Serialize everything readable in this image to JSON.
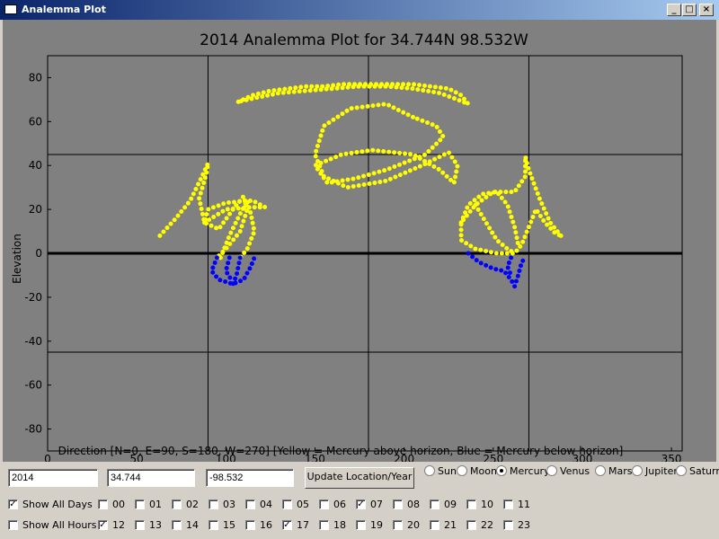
{
  "window": {
    "title": "Analemma Plot",
    "minimize": "_",
    "maximize": "□",
    "close": "×"
  },
  "plot": {
    "title": "2014 Analemma Plot for  34.744N  98.532W",
    "xlabel": "Direction [N=0, E=90, S=180, W=270] [Yellow = Mercury above horizon, Blue = Mercury below horizon]",
    "ylabel": "Elevation",
    "xticks": [
      "0",
      "50",
      "100",
      "150",
      "200",
      "250",
      "300",
      "350"
    ],
    "yticks": [
      "80",
      "60",
      "40",
      "20",
      "0",
      "-20",
      "-40",
      "-60",
      "-80"
    ],
    "colors": {
      "above": "#ffff00",
      "below": "#0000ff",
      "background": "#808080"
    }
  },
  "chart_data": {
    "type": "scatter",
    "title": "2014 Analemma Plot for  34.744N  98.532W",
    "xlabel": "Direction [N=0, E=90, S=180, W=270] [Yellow = Mercury above horizon, Blue = Mercury below horizon]",
    "ylabel": "Elevation",
    "xlim": [
      0,
      356
    ],
    "ylim": [
      -90,
      90
    ],
    "xticks": [
      0,
      50,
      100,
      150,
      200,
      250,
      300,
      350
    ],
    "yticks": [
      80,
      60,
      40,
      20,
      0,
      -20,
      -40,
      -60,
      -80
    ],
    "reference_lines": {
      "vertical": [
        90,
        180,
        270
      ],
      "horizontal": [
        45,
        0,
        -45
      ]
    },
    "series": [
      {
        "color": "#ffff00",
        "curves": [
          [
            [
              107,
              69
            ],
            [
              115,
              72
            ],
            [
              125,
              74
            ],
            [
              135,
              75
            ],
            [
              145,
              76
            ],
            [
              155,
              76
            ],
            [
              165,
              77
            ],
            [
              175,
              77
            ],
            [
              185,
              77
            ],
            [
              195,
              77
            ],
            [
              205,
              77
            ],
            [
              215,
              76
            ],
            [
              225,
              75
            ],
            [
              232,
              72
            ],
            [
              236,
              68
            ],
            [
              230,
              70
            ],
            [
              220,
              73
            ],
            [
              205,
              75
            ],
            [
              190,
              76
            ],
            [
              175,
              76
            ],
            [
              160,
              75
            ],
            [
              145,
              74
            ],
            [
              130,
              73
            ],
            [
              118,
              71
            ],
            [
              107,
              69
            ]
          ],
          [
            [
              205,
              62
            ],
            [
              190,
              68
            ],
            [
              170,
              66
            ],
            [
              155,
              58
            ],
            [
              150,
              45
            ],
            [
              155,
              35
            ],
            [
              168,
              30
            ],
            [
              190,
              33
            ],
            [
              210,
              40
            ],
            [
              225,
              46
            ],
            [
              230,
              40
            ],
            [
              228,
              32
            ],
            [
              220,
              38
            ],
            [
              205,
              45
            ],
            [
              182,
              47
            ],
            [
              165,
              45
            ],
            [
              150,
              40
            ],
            [
              157,
              32
            ],
            [
              172,
              34
            ],
            [
              190,
              38
            ],
            [
              212,
              45
            ],
            [
              222,
              53
            ],
            [
              218,
              58
            ],
            [
              205,
              62
            ]
          ],
          [
            [
              63,
              8
            ],
            [
              72,
              16
            ],
            [
              80,
              24
            ],
            [
              86,
              34
            ],
            [
              90,
              41
            ],
            [
              89,
              36
            ],
            [
              85,
              25
            ],
            [
              88,
              14
            ],
            [
              96,
              11
            ],
            [
              104,
              20
            ],
            [
              110,
              26
            ],
            [
              112,
              20
            ],
            [
              108,
              10
            ],
            [
              100,
              2
            ],
            [
              95,
              -2
            ]
          ],
          [
            [
              88,
              14
            ],
            [
              100,
              20
            ],
            [
              115,
              21
            ],
            [
              122,
              21
            ],
            [
              115,
              24
            ],
            [
              100,
              23
            ],
            [
              90,
              20
            ],
            [
              88,
              14
            ]
          ],
          [
            [
              97,
              -2
            ],
            [
              102,
              8
            ],
            [
              108,
              18
            ],
            [
              112,
              24
            ],
            [
              114,
              18
            ],
            [
              116,
              10
            ],
            [
              112,
              2
            ],
            [
              108,
              -2
            ]
          ],
          [
            [
              288,
              8
            ],
            [
              282,
              14
            ],
            [
              276,
              25
            ],
            [
              270,
              38
            ],
            [
              268,
              44
            ],
            [
              268,
              35
            ],
            [
              262,
              28
            ],
            [
              250,
              28
            ],
            [
              240,
              22
            ],
            [
              232,
              14
            ],
            [
              232,
              6
            ],
            [
              240,
              2
            ],
            [
              252,
              0
            ],
            [
              262,
              0
            ],
            [
              266,
              4
            ],
            [
              270,
              12
            ],
            [
              274,
              20
            ],
            [
              279,
              14
            ],
            [
              285,
              9
            ],
            [
              288,
              8
            ]
          ],
          [
            [
              232,
              14
            ],
            [
              236,
              22
            ],
            [
              244,
              27
            ],
            [
              252,
              28
            ],
            [
              258,
              22
            ],
            [
              262,
              12
            ],
            [
              264,
              4
            ]
          ],
          [
            [
              240,
              22
            ],
            [
              246,
              14
            ],
            [
              252,
              6
            ],
            [
              258,
              2
            ],
            [
              262,
              0
            ]
          ]
        ]
      },
      {
        "color": "#0000ff",
        "curves": [
          [
            [
              95,
              -2
            ],
            [
              92,
              -8
            ],
            [
              96,
              -12
            ],
            [
              104,
              -14
            ],
            [
              110,
              -12
            ],
            [
              114,
              -6
            ],
            [
              116,
              -2
            ]
          ],
          [
            [
              102,
              -2
            ],
            [
              100,
              -8
            ],
            [
              103,
              -12
            ]
          ],
          [
            [
              108,
              -2
            ],
            [
              106,
              -10
            ],
            [
              104,
              -14
            ]
          ],
          [
            [
              236,
              0
            ],
            [
              242,
              -4
            ],
            [
              250,
              -7
            ],
            [
              256,
              -8
            ],
            [
              260,
              -12
            ],
            [
              262,
              -15
            ],
            [
              264,
              -10
            ],
            [
              266,
              -4
            ],
            [
              268,
              -2
            ]
          ],
          [
            [
              260,
              -2
            ],
            [
              258,
              -6
            ],
            [
              260,
              -10
            ]
          ]
        ]
      }
    ]
  },
  "controls": {
    "year": "2014",
    "lat": "34.744",
    "lon": "-98.532",
    "update_label": "Update Location/Year",
    "bodies": [
      {
        "label": "Sun",
        "selected": false
      },
      {
        "label": "Moon",
        "selected": false
      },
      {
        "label": "Mercury",
        "selected": true
      },
      {
        "label": "Venus",
        "selected": false
      },
      {
        "label": "Mars",
        "selected": false
      },
      {
        "label": "Jupiter",
        "selected": false
      },
      {
        "label": "Saturn",
        "selected": false
      }
    ],
    "show_all_days": {
      "label": "Show All Days",
      "checked": true
    },
    "show_all_hours": {
      "label": "Show All Hours",
      "checked": false
    },
    "hours_row1": [
      {
        "label": "00",
        "checked": false
      },
      {
        "label": "01",
        "checked": false
      },
      {
        "label": "02",
        "checked": false
      },
      {
        "label": "03",
        "checked": false
      },
      {
        "label": "04",
        "checked": false
      },
      {
        "label": "05",
        "checked": false
      },
      {
        "label": "06",
        "checked": false
      },
      {
        "label": "07",
        "checked": true
      },
      {
        "label": "08",
        "checked": false
      },
      {
        "label": "09",
        "checked": false
      },
      {
        "label": "10",
        "checked": false
      },
      {
        "label": "11",
        "checked": false
      }
    ],
    "hours_row2": [
      {
        "label": "12",
        "checked": true
      },
      {
        "label": "13",
        "checked": false
      },
      {
        "label": "14",
        "checked": false
      },
      {
        "label": "15",
        "checked": false
      },
      {
        "label": "16",
        "checked": false
      },
      {
        "label": "17",
        "checked": true
      },
      {
        "label": "18",
        "checked": false
      },
      {
        "label": "19",
        "checked": false
      },
      {
        "label": "20",
        "checked": false
      },
      {
        "label": "21",
        "checked": false
      },
      {
        "label": "22",
        "checked": false
      },
      {
        "label": "23",
        "checked": false
      }
    ]
  }
}
